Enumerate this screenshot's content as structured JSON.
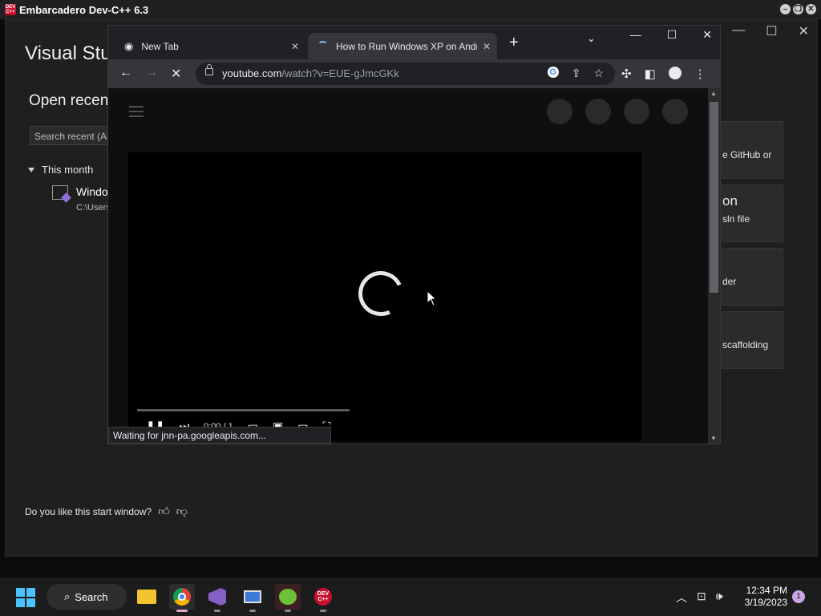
{
  "devcpp": {
    "title": "Embarcadero Dev-C++ 6.3",
    "icon_text": "DEV C++"
  },
  "vs": {
    "title": "Visual Stu",
    "open_recent": "Open recent",
    "search_placeholder": "Search recent (Alt",
    "group_label": "This month",
    "recent_item": {
      "name": "Windo",
      "path": "C:\\Users"
    },
    "cards": [
      {
        "line1": "e GitHub or",
        "line2": ""
      },
      {
        "line1": "on",
        "line2": "sln file"
      },
      {
        "line1": "der",
        "line2": ""
      },
      {
        "line1": "scaffolding",
        "line2": ""
      }
    ],
    "feedback": "Do you like this start window?"
  },
  "chrome": {
    "tabs": [
      {
        "label": "New Tab"
      },
      {
        "label": "How to Run Windows XP on Android"
      }
    ],
    "url_host": "youtube.com",
    "url_path": "/watch?v=EUE-gJmcGKk",
    "status": "Waiting for jnn-pa.googleapis.com...",
    "player_time": "0:00 / 1"
  },
  "taskbar": {
    "search_label": "Search",
    "time": "12:34 PM",
    "date": "3/19/2023",
    "notification_count": "1",
    "devcpp_icon_text": "DEV C++"
  },
  "colors": {
    "accent_blue": "#8ab4f8",
    "windows_blue": "#4cc2ff",
    "devcpp_red": "#c8102e"
  }
}
